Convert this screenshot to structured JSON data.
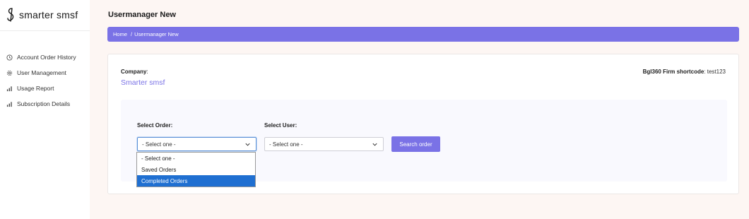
{
  "brand": {
    "name": "smarter smsf"
  },
  "sidebar": {
    "items": [
      {
        "label": "Account Order History",
        "icon": "clock-icon"
      },
      {
        "label": "User Management",
        "icon": "gear-icon"
      },
      {
        "label": "Usage Report",
        "icon": "bar-chart-icon"
      },
      {
        "label": "Subscription Details",
        "icon": "bar-chart-icon"
      }
    ]
  },
  "page": {
    "title": "Usermanager New",
    "breadcrumb": {
      "home": "Home",
      "separator": "/",
      "current": "Usermanager New"
    }
  },
  "card": {
    "company_label": "Company",
    "company_colon": ":",
    "company_name": "Smarter smsf",
    "firm_code_label": "Bgl360 Firm shortcode",
    "firm_code_value": ": test123"
  },
  "filters": {
    "order_label": "Select Order:",
    "order_value": "- Select one -",
    "order_options": [
      "- Select one -",
      "Saved Orders",
      "Completed Orders"
    ],
    "order_highlighted": "Completed Orders",
    "user_label": "Select User:",
    "user_value": "- Select one -",
    "search_button": "Search order"
  },
  "colors": {
    "accent": "#7a72e6",
    "background": "#fdf6f3",
    "dropdown_highlight": "#1f6fd1"
  }
}
